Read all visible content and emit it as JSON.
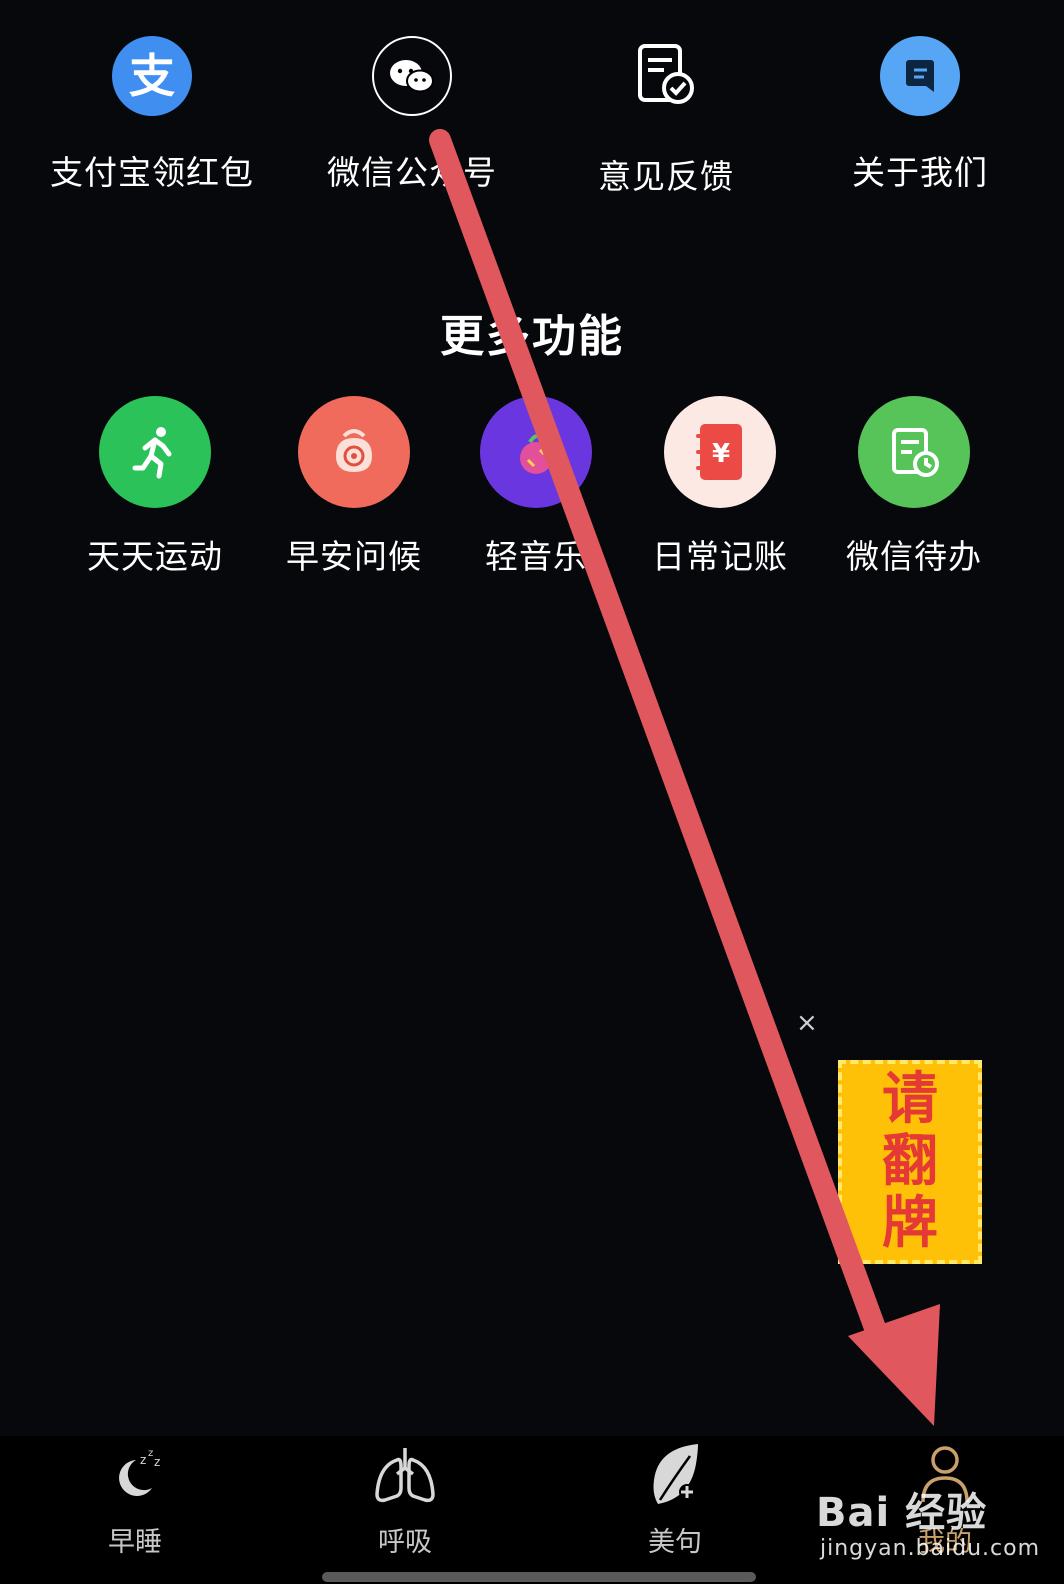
{
  "top_row": [
    {
      "label": "支付宝领红包",
      "icon": "alipay-icon",
      "color": "#3f8ef0"
    },
    {
      "label": "微信公众号",
      "icon": "wechat-icon",
      "color": "#000000"
    },
    {
      "label": "意见反馈",
      "icon": "feedback-icon",
      "color": "#ffffff"
    },
    {
      "label": "关于我们",
      "icon": "about-icon",
      "color": "#3f8ef0"
    }
  ],
  "more_section": {
    "title": "更多功能",
    "items": [
      {
        "label": "天天运动",
        "icon": "running-icon",
        "color": "#2cc25a"
      },
      {
        "label": "早安问候",
        "icon": "greeting-icon",
        "color": "#f06b5c"
      },
      {
        "label": "轻音乐",
        "icon": "music-icon",
        "color": "#6a36e0"
      },
      {
        "label": "日常记账",
        "icon": "ledger-icon",
        "color": "#fde9e4"
      },
      {
        "label": "微信待办",
        "icon": "todo-icon",
        "color": "#57c45a"
      }
    ]
  },
  "promo": {
    "text": [
      "请",
      "翻",
      "牌"
    ],
    "close": "×"
  },
  "tabs": [
    {
      "label": "早睡",
      "icon": "moon-sleep-icon"
    },
    {
      "label": "呼吸",
      "icon": "lungs-icon"
    },
    {
      "label": "美句",
      "icon": "leaf-icon"
    },
    {
      "label": "我的",
      "icon": "person-icon",
      "active": true
    }
  ],
  "watermark": {
    "brand": "Bai 经验",
    "url": "jingyan.baidu.com"
  },
  "colors": {
    "background": "#07080c",
    "arrow": "#e0585e",
    "active_tab": "#c7a06a"
  }
}
